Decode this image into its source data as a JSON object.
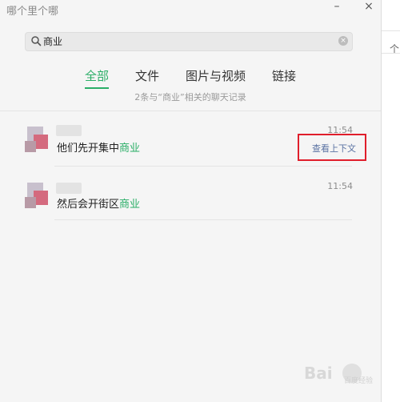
{
  "window": {
    "title": "哪个里个哪",
    "minimize_label": "–",
    "close_label": "×"
  },
  "search": {
    "value": "商业",
    "icon": "search-icon",
    "clear_icon": "clear-icon",
    "clear_label": "×"
  },
  "tabs": [
    {
      "label": "全部",
      "active": true
    },
    {
      "label": "文件",
      "active": false
    },
    {
      "label": "图片与视频",
      "active": false
    },
    {
      "label": "链接",
      "active": false
    }
  ],
  "summary": "2条与“商业”相关的聊天记录",
  "results": [
    {
      "time": "11:54",
      "message_prefix": "他们先开集中",
      "message_highlight": "商业",
      "action_label": "查看上下文"
    },
    {
      "time": "11:54",
      "message_prefix": "然后会开街区",
      "message_highlight": "商业"
    }
  ],
  "right_strip": {
    "glyph": "个"
  },
  "watermark": {
    "text": "Bai",
    "sub": "百度经验"
  },
  "colors": {
    "accent": "#2aae67",
    "highlight_box": "#e01e2b",
    "link": "#5b73a3"
  }
}
